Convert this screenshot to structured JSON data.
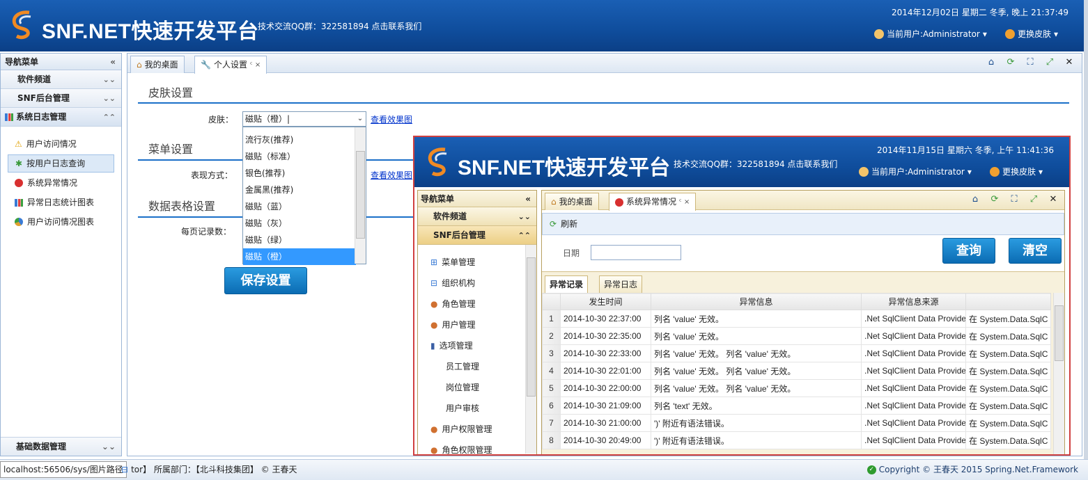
{
  "header": {
    "title": "SNF.NET快速开发平台",
    "qq": "技术交流QQ群：322581894 点击联系我们",
    "datetime": "2014年12月02日 星期二 冬季, 晚上 21:37:49",
    "user": "当前用户:Administrator",
    "skin": "更换皮肤"
  },
  "sidebar": {
    "title": "导航菜单",
    "collapse": "«",
    "groups": [
      "软件频道",
      "SNF后台管理",
      "系统日志管理"
    ],
    "items": [
      "用户访问情况",
      "按用户日志查询",
      "系统异常情况",
      "异常日志统计图表",
      "用户访问情况图表"
    ],
    "footer": "基础数据管理"
  },
  "tabs": {
    "desk": "我的桌面",
    "settings": "个人设置",
    "tab_ctrl": "ᶜ ×"
  },
  "settings": {
    "skin_section": "皮肤设置",
    "skin_label": "皮肤：",
    "skin_value": "磁贴（橙）|",
    "view_link": "查看效果图",
    "menu_section": "菜单设置",
    "menu_label": "表现方式：",
    "menu_link": "查看效果图",
    "grid_section": "数据表格设置",
    "grid_label": "每页记录数：",
    "save": "保存设置",
    "options": [
      "流行灰(推荐)",
      "磁贴（标准）",
      "银色(推荐)",
      "金属黑(推荐)",
      "磁贴（蓝）",
      "磁贴（灰）",
      "磁贴（绿）",
      "磁贴（橙）"
    ]
  },
  "preview": {
    "title": "SNF.NET快速开发平台",
    "qq": "技术交流QQ群：322581894 点击联系我们",
    "datetime": "2014年11月15日 星期六 冬季, 上午 11:41:36",
    "user": "当前用户:Administrator",
    "skin": "更换皮肤",
    "nav_title": "导航菜单",
    "groups": [
      "软件频道",
      "SNF后台管理"
    ],
    "items": [
      "菜单管理",
      "组织机构",
      "角色管理",
      "用户管理",
      "选项管理",
      "员工管理",
      "岗位管理",
      "用户审核",
      "用户权限管理",
      "角色权限管理"
    ],
    "tab_desk": "我的桌面",
    "tab_error": "系统异常情况",
    "refresh": "刷新",
    "date_label": "日期",
    "query": "查询",
    "clear": "清空",
    "grid_tabs": [
      "异常记录",
      "异常日志"
    ],
    "columns": [
      "发生时间",
      "异常信息",
      "异常信息来源"
    ],
    "rows": [
      [
        "1",
        "2014-10-30 22:37:00",
        "列名 'value' 无效。",
        ".Net SqlClient Data Provide",
        "在 System.Data.SqlC"
      ],
      [
        "2",
        "2014-10-30 22:35:00",
        "列名 'value' 无效。",
        ".Net SqlClient Data Provide",
        "在 System.Data.SqlC"
      ],
      [
        "3",
        "2014-10-30 22:33:00",
        "列名 'value' 无效。 列名 'value' 无效。",
        ".Net SqlClient Data Provide",
        "在 System.Data.SqlC"
      ],
      [
        "4",
        "2014-10-30 22:01:00",
        "列名 'value' 无效。 列名 'value' 无效。",
        ".Net SqlClient Data Provide",
        "在 System.Data.SqlC"
      ],
      [
        "5",
        "2014-10-30 22:00:00",
        "列名 'value' 无效。 列名 'value' 无效。",
        ".Net SqlClient Data Provide",
        "在 System.Data.SqlC"
      ],
      [
        "6",
        "2014-10-30 21:09:00",
        "列名 'text' 无效。",
        ".Net SqlClient Data Provide",
        "在 System.Data.SqlC"
      ],
      [
        "7",
        "2014-10-30 21:00:00",
        "')' 附近有语法错误。",
        ".Net SqlClient Data Provide",
        "在 System.Data.SqlC"
      ],
      [
        "8",
        "2014-10-30 20:49:00",
        "')' 附近有语法错误。",
        ".Net SqlClient Data Provide",
        "在 System.Data.SqlC"
      ]
    ]
  },
  "status": {
    "url": "localhost:56506/sys/图片路径",
    "dept": "tor】 所属部门：【北斗科技集团】 © 王春天",
    "copyright": "Copyright © 王春天 2015 Spring.Net.Framework"
  },
  "colors": {
    "header": "#0f4d9c",
    "accent": "#1a6fc8",
    "preview_border": "#d04040",
    "selected": "#3399ff"
  }
}
